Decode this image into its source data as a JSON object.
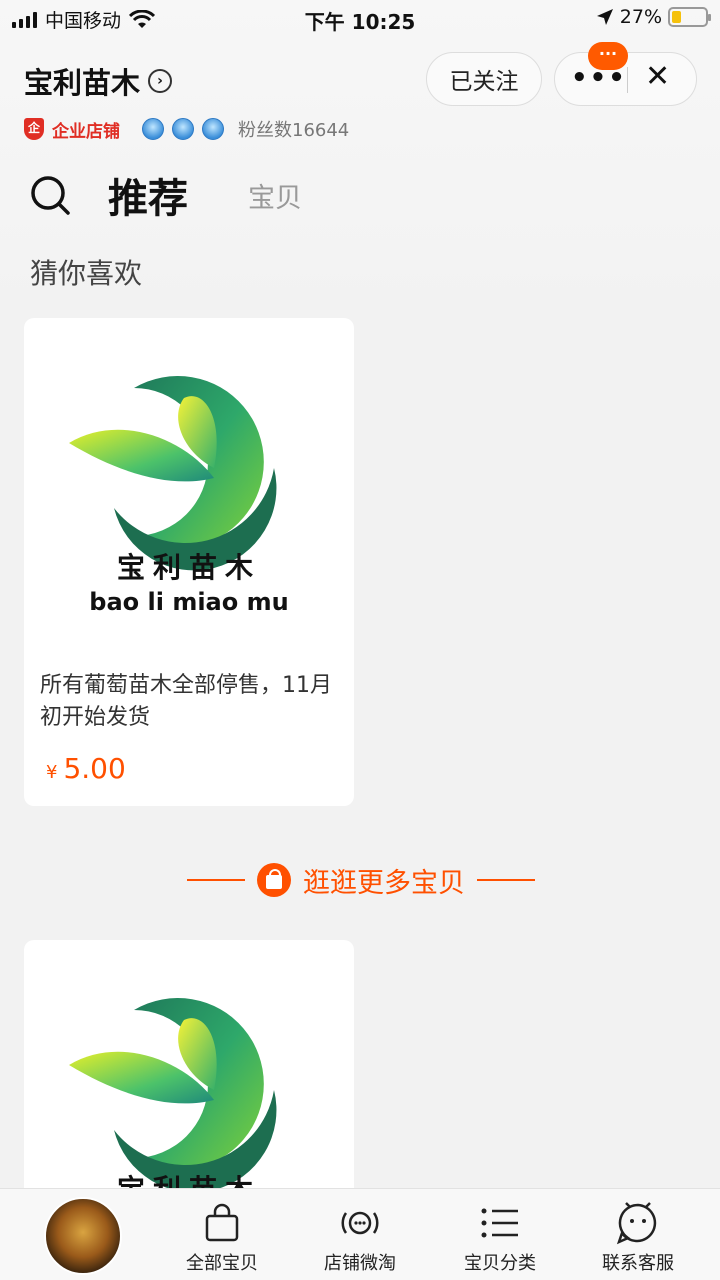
{
  "status_bar": {
    "carrier": "中国移动",
    "time": "下午 10:25",
    "battery": "27%",
    "battery_level": 0.27,
    "icons": [
      "signal-icon",
      "wifi-icon",
      "location-arrow-icon",
      "battery-icon"
    ]
  },
  "header": {
    "shop_name": "宝利苗木",
    "follow_label": "已关注",
    "more_label": "•••",
    "close_label": "✕",
    "badge_text": "···",
    "enterprise_icon": "企",
    "enterprise_label": "企业店铺",
    "crown_count": 3,
    "fans_label": "粉丝数16644"
  },
  "tabs": {
    "active": "推荐",
    "inactive": "宝贝"
  },
  "section": {
    "title": "猜你喜欢"
  },
  "products": [
    {
      "logo_cn": "宝利苗木",
      "logo_en": "bao li miao mu",
      "description": "所有葡萄苗木全部停售，11月初开始发货",
      "price_symbol": "¥",
      "price": "5.00"
    },
    {
      "logo_cn": "宝利苗木"
    }
  ],
  "more": {
    "label": "逛逛更多宝贝"
  },
  "bottom_nav": [
    {
      "label": "全部宝贝",
      "icon": "shopping-bag-icon"
    },
    {
      "label": "店铺微淘",
      "icon": "broadcast-chat-icon"
    },
    {
      "label": "宝贝分类",
      "icon": "list-icon"
    },
    {
      "label": "联系客服",
      "icon": "chat-face-icon"
    }
  ],
  "colors": {
    "accent": "#ff5000",
    "enterprise_red": "#e02e24",
    "badge": "#ff5a00"
  }
}
